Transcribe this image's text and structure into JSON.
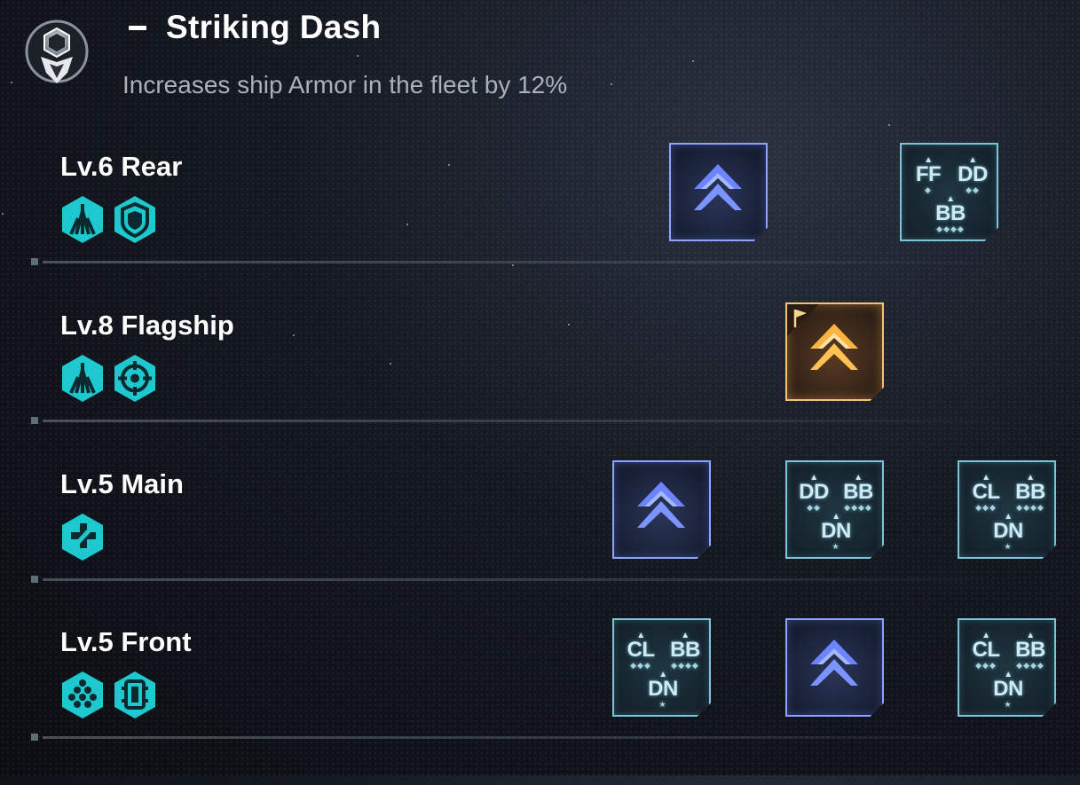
{
  "header": {
    "title": "Striking Dash",
    "description": "Increases ship Armor in the fleet by 12%"
  },
  "rows": [
    {
      "label": "Lv.6 Rear",
      "badges": [
        "missile-ship-icon",
        "shield-icon"
      ],
      "cards": [
        {
          "type": "chevron",
          "color": "blue"
        },
        {
          "type": "ships",
          "top": [
            {
              "label": "FF",
              "tag": "◆"
            },
            {
              "label": "DD",
              "tag": "◆◆"
            }
          ],
          "bottom": {
            "label": "BB",
            "tag": "◆◆◆◆"
          }
        }
      ]
    },
    {
      "label": "Lv.8 Flagship",
      "badges": [
        "missile-ship-icon",
        "crosshair-icon"
      ],
      "cards": [
        {
          "type": "chevron",
          "color": "gold",
          "flag": true
        }
      ]
    },
    {
      "label": "Lv.5 Main",
      "badges": [
        "plus-cross-icon"
      ],
      "cards": [
        {
          "type": "chevron",
          "color": "blue"
        },
        {
          "type": "ships",
          "top": [
            {
              "label": "DD",
              "tag": "◆◆"
            },
            {
              "label": "BB",
              "tag": "◆◆◆◆"
            }
          ],
          "bottom": {
            "label": "DN",
            "tag": "★"
          }
        },
        {
          "type": "ships",
          "top": [
            {
              "label": "CL",
              "tag": "◆◆◆"
            },
            {
              "label": "BB",
              "tag": "◆◆◆◆"
            }
          ],
          "bottom": {
            "label": "DN",
            "tag": "★"
          }
        }
      ]
    },
    {
      "label": "Lv.5 Front",
      "badges": [
        "hexagon-cluster-icon",
        "ship-module-icon"
      ],
      "cards": [
        {
          "type": "ships",
          "top": [
            {
              "label": "CL",
              "tag": "◆◆◆"
            },
            {
              "label": "BB",
              "tag": "◆◆◆◆"
            }
          ],
          "bottom": {
            "label": "DN",
            "tag": "★"
          }
        },
        {
          "type": "chevron",
          "color": "blue"
        },
        {
          "type": "ships",
          "top": [
            {
              "label": "CL",
              "tag": "◆◆◆"
            },
            {
              "label": "BB",
              "tag": "◆◆◆◆"
            }
          ],
          "bottom": {
            "label": "DN",
            "tag": "★"
          }
        }
      ]
    }
  ],
  "colors": {
    "badge": "#1ec8cf",
    "blue_card": "#8ea2ff",
    "teal_card": "#7fc3d8",
    "gold_card": "#f1c27a"
  }
}
